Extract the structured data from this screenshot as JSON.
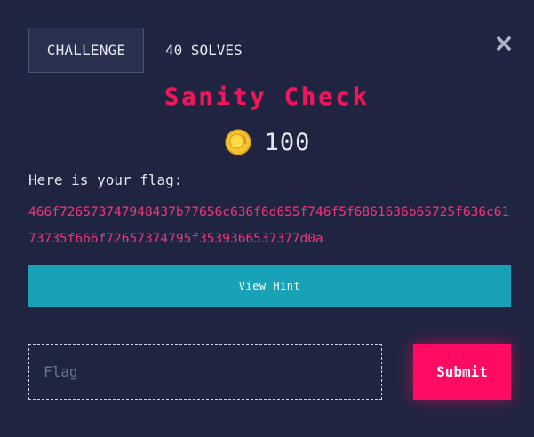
{
  "tabs": {
    "challenge_label": "CHALLENGE",
    "solves_label": "40 SOLVES"
  },
  "close": {
    "icon": "close-icon"
  },
  "challenge": {
    "title": "Sanity Check",
    "points": "100",
    "points_icon": "coin-icon",
    "description": "Here is your flag:",
    "flag": "466f726573747948437b77656c636f6d655f746f5f6861636b65725f636c6173735f666f72657374795f3539366537377d0a"
  },
  "hint": {
    "label": "View Hint"
  },
  "submission": {
    "placeholder": "Flag",
    "value": "",
    "submit_label": "Submit"
  },
  "colors": {
    "background": "#1f2540",
    "accent_pink": "#f0165c",
    "hint_teal": "#17a2b8",
    "submit_pink": "#ff0b63"
  }
}
